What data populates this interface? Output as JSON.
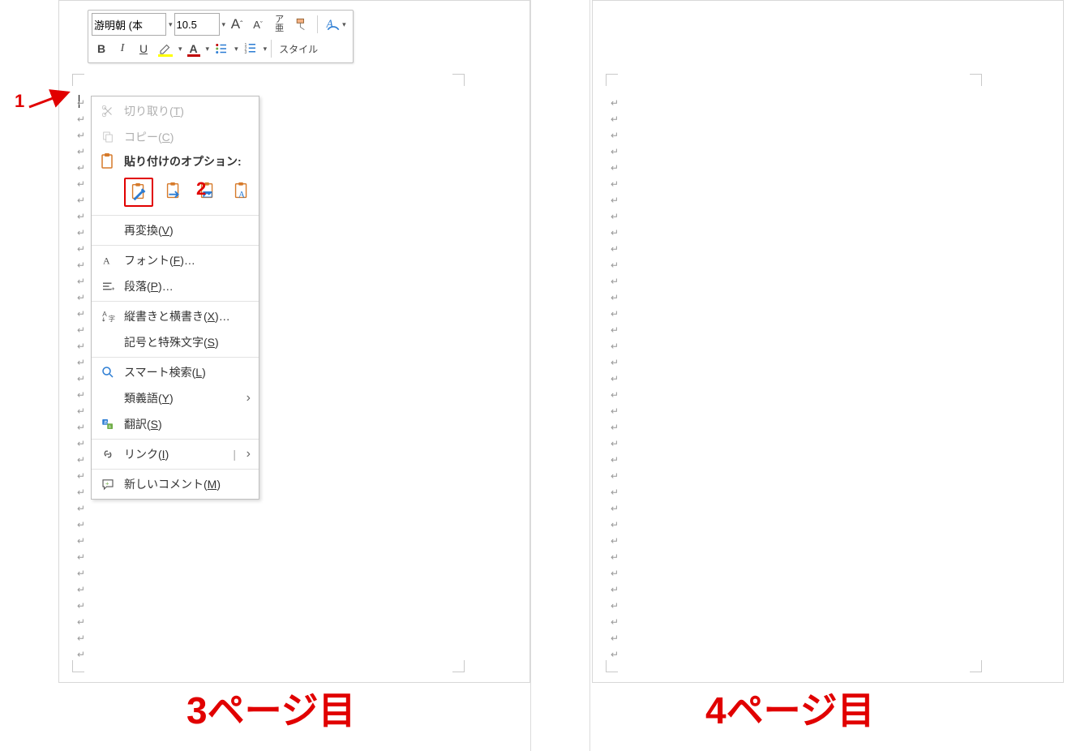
{
  "mini_toolbar": {
    "font_name": "游明朝 (本",
    "font_size": "10.5",
    "grow_font": "A",
    "shrink_font": "A",
    "ruby_top": "ア",
    "ruby_bottom": "亜",
    "bold": "B",
    "italic": "I",
    "underline": "U",
    "highlight_glyph": "ab",
    "font_color_glyph": "A",
    "style_label": "スタイル"
  },
  "context_menu": {
    "cut": "切り取り",
    "cut_key": "T",
    "copy": "コピー",
    "copy_key": "C",
    "paste_title": "貼り付けのオプション:",
    "reconvert": "再変換",
    "reconvert_key": "V",
    "font": "フォント",
    "font_key": "F",
    "paragraph": "段落",
    "paragraph_key": "P",
    "text_direction": "縦書きと横書き",
    "text_direction_key": "X",
    "symbols": "記号と特殊文字",
    "symbols_key": "S",
    "smart_lookup": "スマート検索",
    "smart_lookup_key": "L",
    "synonyms": "類義語",
    "synonyms_key": "Y",
    "translate": "翻訳",
    "translate_key": "S",
    "link": "リンク",
    "link_key": "I",
    "new_comment": "新しいコメント",
    "new_comment_key": "M",
    "ellipsis": "…"
  },
  "annotations": {
    "num1": "1",
    "num2": "2",
    "page_left": "3ページ目",
    "page_right": "4ページ目"
  },
  "marks": {
    "para": "↵"
  },
  "colors": {
    "annotation": "#e10000",
    "clipboard_orange": "#d67a2a",
    "clipboard_blue": "#2b7cd3"
  }
}
